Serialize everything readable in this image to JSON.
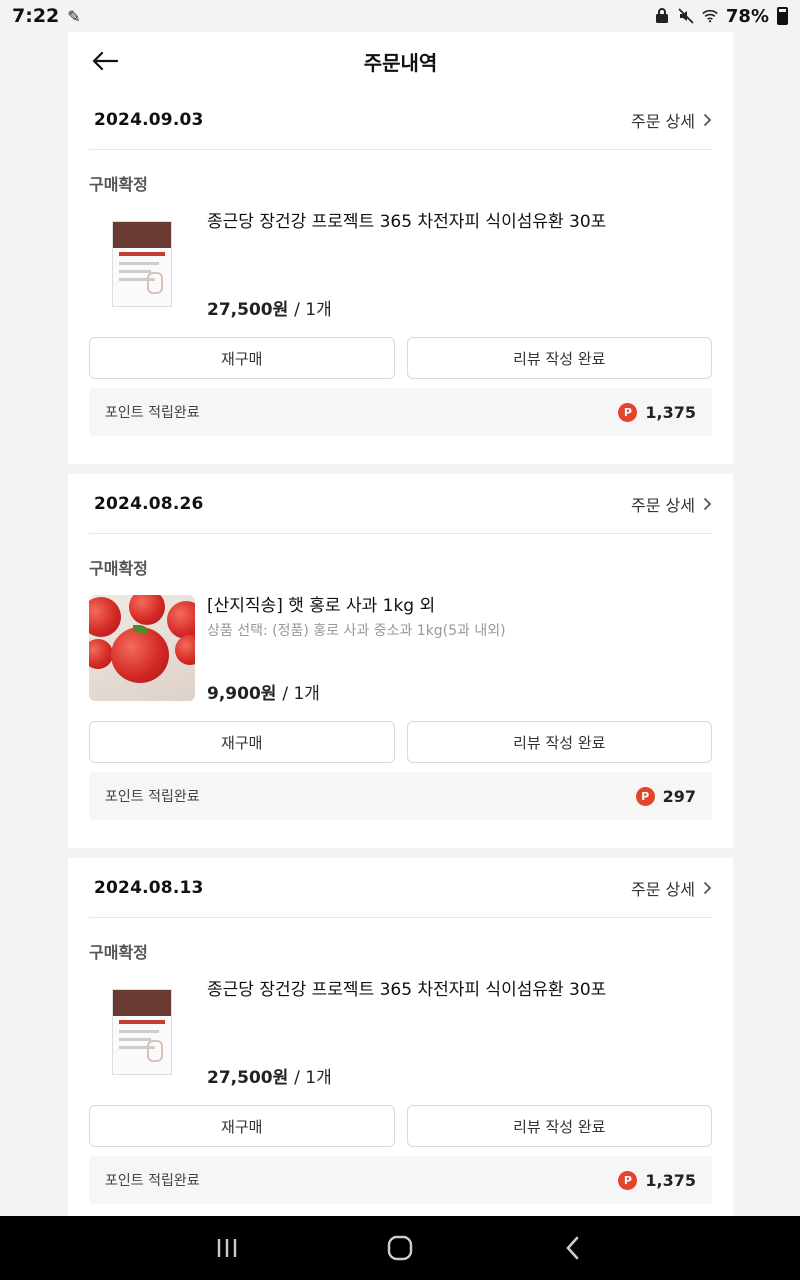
{
  "status_bar": {
    "time": "7:22",
    "battery": "78%"
  },
  "header": {
    "title": "주문내역"
  },
  "orders": [
    {
      "date": "2024.09.03",
      "detail_label": "주문 상세",
      "status": "구매확정",
      "product_name": "종근당 장건강 프로젝트 365 차전자피 식이섬유환 30포",
      "product_option": "",
      "price": "27,500원",
      "quantity": "/ 1개",
      "thumbnail": "supplement-box",
      "rebuy_label": "재구매",
      "review_label": "리뷰 작성 완료",
      "point_label": "포인트 적립완료",
      "point_badge": "P",
      "point_value": "1,375"
    },
    {
      "date": "2024.08.26",
      "detail_label": "주문 상세",
      "status": "구매확정",
      "product_name": "[산지직송] 햇 홍로 사과 1kg 외",
      "product_option": "상품 선택: (정품) 홍로 사과 중소과 1kg(5과 내외)",
      "price": "9,900원",
      "quantity": "/ 1개",
      "thumbnail": "apples",
      "rebuy_label": "재구매",
      "review_label": "리뷰 작성 완료",
      "point_label": "포인트 적립완료",
      "point_badge": "P",
      "point_value": "297"
    },
    {
      "date": "2024.08.13",
      "detail_label": "주문 상세",
      "status": "구매확정",
      "product_name": "종근당 장건강 프로젝트 365 차전자피 식이섬유환 30포",
      "product_option": "",
      "price": "27,500원",
      "quantity": "/ 1개",
      "thumbnail": "supplement-box",
      "rebuy_label": "재구매",
      "review_label": "리뷰 작성 완료",
      "point_label": "포인트 적립완료",
      "point_badge": "P",
      "point_value": "1,375"
    }
  ],
  "colors": {
    "point_badge": "#e2452a",
    "background": "#f3f3f3",
    "card": "#ffffff"
  }
}
